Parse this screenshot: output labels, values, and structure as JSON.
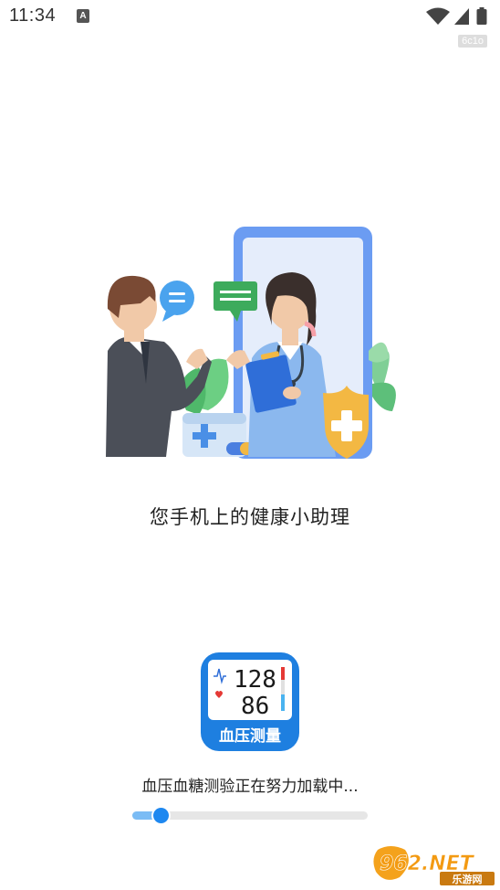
{
  "status_bar": {
    "time": "11:34",
    "notification_icon_letter": "A",
    "signal_icon": "wifi-icon",
    "cell_icon": "cell-signal-icon",
    "battery_icon": "battery-icon"
  },
  "build_tag": "6c1o",
  "splash": {
    "illustration": "doctor-consultation-illustration",
    "tagline": "您手机上的健康小助理"
  },
  "app_icon": {
    "systolic": "128",
    "diastolic": "86",
    "label": "血压测量",
    "accent_color": "#1e7fe0"
  },
  "loading": {
    "text": "血压血糖测验正在努力加载中...",
    "progress": 0.12
  },
  "watermark": {
    "logo_text": "962.NET",
    "subtitle": "乐游网"
  }
}
